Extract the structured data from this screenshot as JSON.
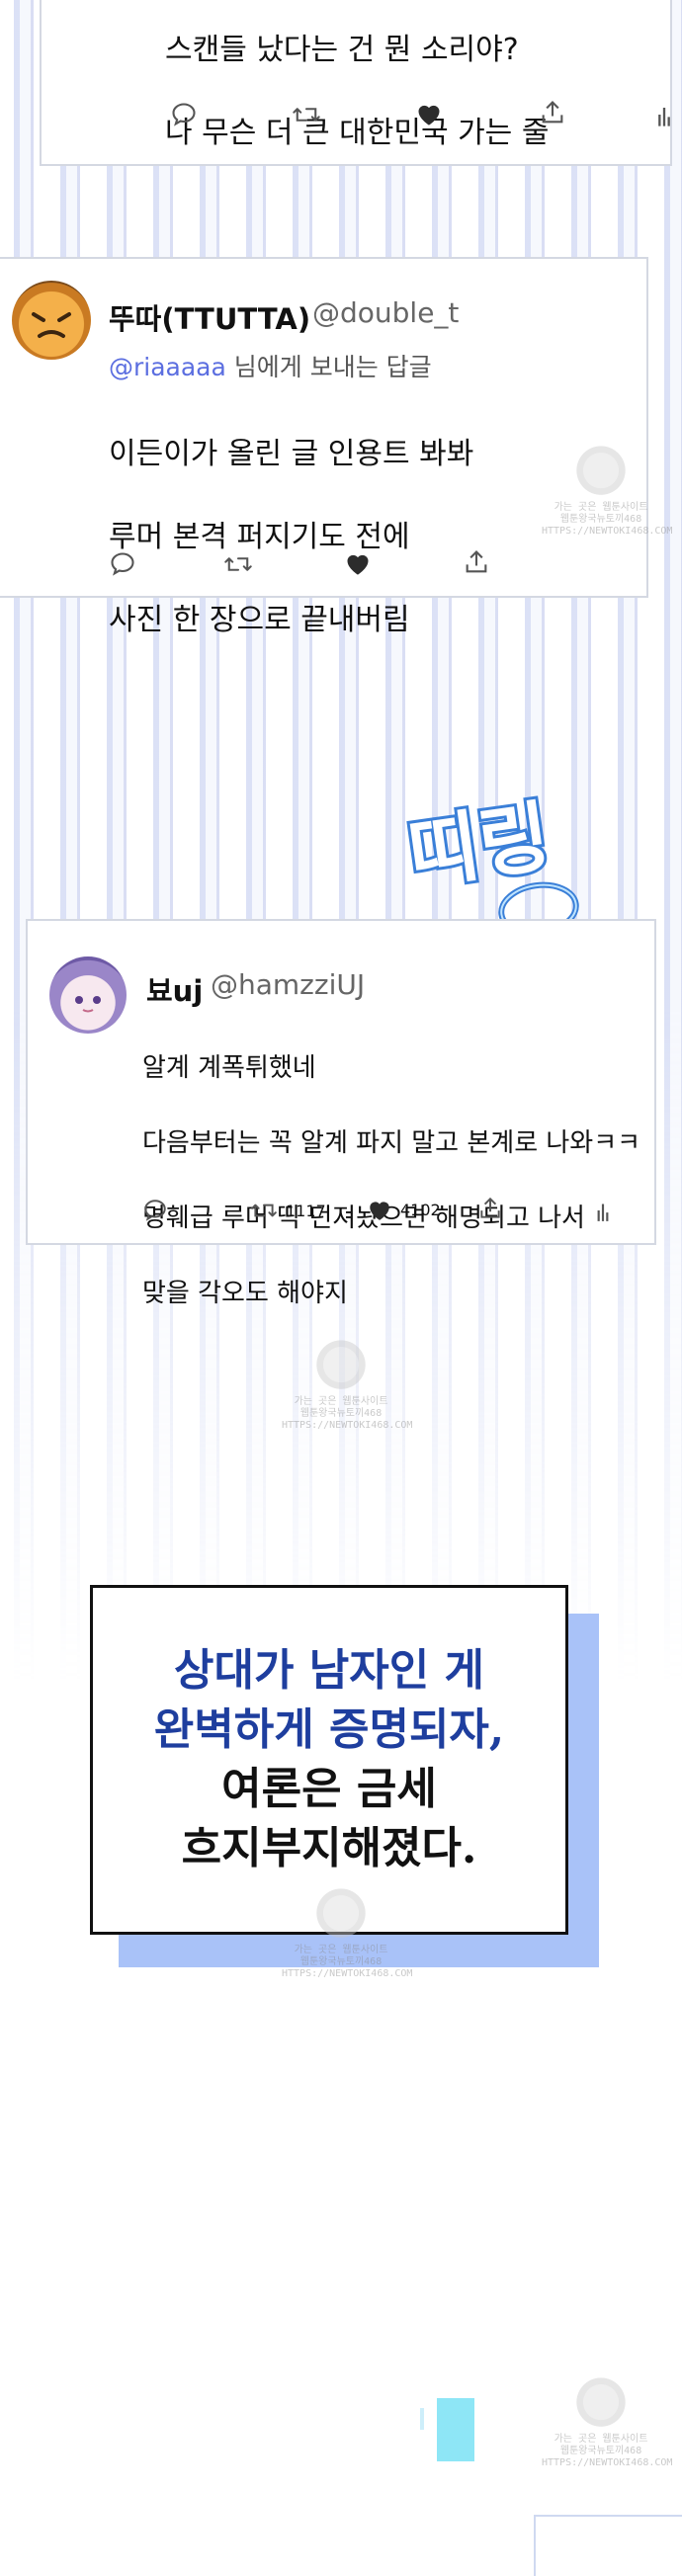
{
  "tweet1": {
    "text_lines": [
      "스캔들 났다는 건 뭔 소리야?",
      "나 무슨 더 큰 대한민국 가는 줄"
    ],
    "icons": [
      "reply-icon",
      "retweet-icon",
      "like-icon-filled",
      "share-icon",
      "analytics-icon"
    ]
  },
  "tweet2": {
    "display_name": "뚜따(TTUTTA)",
    "handle": "@double_t",
    "reply_prefix": "@riaaaaa",
    "reply_suffix": " 님에게 보내는 답글",
    "text_lines": [
      "이든이가 올린 글 인용트 봐봐",
      "루머 본격 퍼지기도 전에",
      "사진 한 장으로 끝내버림"
    ],
    "icons": [
      "reply-icon",
      "retweet-icon",
      "like-icon-filled",
      "share-icon"
    ]
  },
  "sfx": {
    "text": "띠링",
    "color": "#3a7fd8"
  },
  "tweet3": {
    "display_name": "뵤uj",
    "handle": "@hamzziUJ",
    "text_lines": [
      "알계 계폭튀했네",
      "다음부터는 꼭 알계 파지 말고 본계로 나와ㅋㅋ",
      "명훼급 루머 띡 던져놨으면 해명되고 나서",
      "맞을 각오도 해야지"
    ],
    "retweets": "1117",
    "likes": "4102",
    "icons": [
      "reply-icon",
      "retweet-icon",
      "like-icon-filled",
      "share-icon",
      "analytics-icon"
    ]
  },
  "caption": {
    "lines": [
      "상대가 남자인 게",
      "완벽하게 증명되자,",
      "여론은 금세",
      "흐지부지해졌다."
    ],
    "accent_color": "#1e3e9e",
    "back_color": "#a9c2f8"
  },
  "watermark": {
    "line1": "가는 곳은 웹툰사이트",
    "line2": "웹툰왕국뉴토끼468",
    "line3": "HTTPS://NEWTOKI468.COM"
  }
}
